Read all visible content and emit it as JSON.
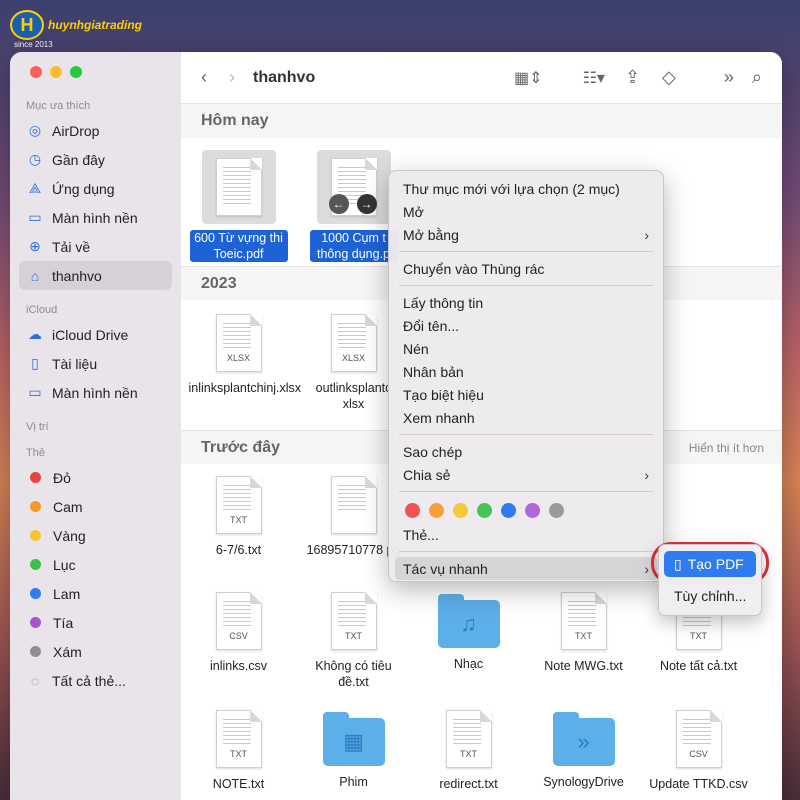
{
  "logo": {
    "mark": "H",
    "text": "huynhgiatrading",
    "sub": "since 2013"
  },
  "toolbar": {
    "title": "thanhvo"
  },
  "sidebar": {
    "sections": [
      {
        "title": "Mục ưa thích",
        "items": [
          {
            "label": "AirDrop",
            "icon": "airdrop-icon",
            "glyph": "◎"
          },
          {
            "label": "Gần đây",
            "icon": "clock-icon",
            "glyph": "◷"
          },
          {
            "label": "Ứng dụng",
            "icon": "apps-icon",
            "glyph": "⟁"
          },
          {
            "label": "Màn hình nền",
            "icon": "desktop-icon",
            "glyph": "▭"
          },
          {
            "label": "Tải về",
            "icon": "download-icon",
            "glyph": "⊕"
          },
          {
            "label": "thanhvo",
            "icon": "home-icon",
            "glyph": "⌂",
            "active": true
          }
        ]
      },
      {
        "title": "iCloud",
        "items": [
          {
            "label": "iCloud Drive",
            "icon": "cloud-icon",
            "glyph": "☁"
          },
          {
            "label": "Tài liệu",
            "icon": "document-icon",
            "glyph": "▯"
          },
          {
            "label": "Màn hình nền",
            "icon": "desktop-icon",
            "glyph": "▭"
          }
        ]
      },
      {
        "title": "Vị trí",
        "items": []
      },
      {
        "title": "Thẻ",
        "items": [
          {
            "label": "Đỏ",
            "color": "#e8423f"
          },
          {
            "label": "Cam",
            "color": "#f39a2b"
          },
          {
            "label": "Vàng",
            "color": "#f7c530"
          },
          {
            "label": "Lục",
            "color": "#3fbf4a"
          },
          {
            "label": "Lam",
            "color": "#2f7bf0"
          },
          {
            "label": "Tía",
            "color": "#a855c9"
          },
          {
            "label": "Xám",
            "color": "#8e8e8e"
          },
          {
            "label": "Tất cả thẻ...",
            "icon": "all-tags-icon",
            "glyph": "◌"
          }
        ]
      }
    ]
  },
  "groups": {
    "today": "Hôm nay",
    "y2023": "2023",
    "earlier": "Trước đây",
    "show_less": "Hiển thị ít hơn"
  },
  "files_today": [
    "600 Từ vựng thi Toeic.pdf",
    "1000 Cụm t thông dụng.p"
  ],
  "files_2023": [
    {
      "name": "inlinksplantchinj.xlsx",
      "ext": "XLSX"
    },
    {
      "name": "outlinksplantc xlsx",
      "ext": "XLSX"
    }
  ],
  "files_earlier_row1": [
    {
      "name": "6-7/6.txt",
      "ext": "TXT"
    },
    {
      "name": "16895710778 pg",
      "ext": ""
    }
  ],
  "files_earlier_row2": [
    {
      "name": "inlinks.csv",
      "ext": "CSV",
      "kind": "doc"
    },
    {
      "name": "Không có tiêu đề.txt",
      "ext": "TXT",
      "kind": "doc"
    },
    {
      "name": "Nhạc",
      "kind": "folder",
      "glyph": "♫"
    },
    {
      "name": "Note MWG.txt",
      "ext": "TXT",
      "kind": "doc"
    },
    {
      "name": "Note tất cả.txt",
      "ext": "TXT",
      "kind": "doc"
    }
  ],
  "files_earlier_row3": [
    {
      "name": "NOTE.txt",
      "ext": "TXT",
      "kind": "doc"
    },
    {
      "name": "Phim",
      "kind": "folder",
      "glyph": "▦"
    },
    {
      "name": "redirect.txt",
      "ext": "TXT",
      "kind": "doc"
    },
    {
      "name": "SynologyDrive",
      "kind": "folder",
      "glyph": "»"
    },
    {
      "name": "Update TTKD.csv",
      "ext": "CSV",
      "kind": "doc"
    }
  ],
  "context_menu": {
    "items": [
      "Thư mục mới với lựa chọn (2 mục)",
      "Mở",
      "Mở bằng",
      "Chuyển vào Thùng rác",
      "Lấy thông tin",
      "Đổi tên...",
      "Nén",
      "Nhân bản",
      "Tạo biệt hiệu",
      "Xem nhanh",
      "Sao chép",
      "Chia sẻ",
      "Thẻ...",
      "Tác vụ nhanh"
    ],
    "colors": [
      "#ef5250",
      "#f5a03a",
      "#f6c83a",
      "#44c458",
      "#2f7bf0",
      "#b067d8",
      "#9a9a9a"
    ]
  },
  "submenu": {
    "create_pdf": "Tạo PDF",
    "customize": "Tùy chỉnh..."
  }
}
